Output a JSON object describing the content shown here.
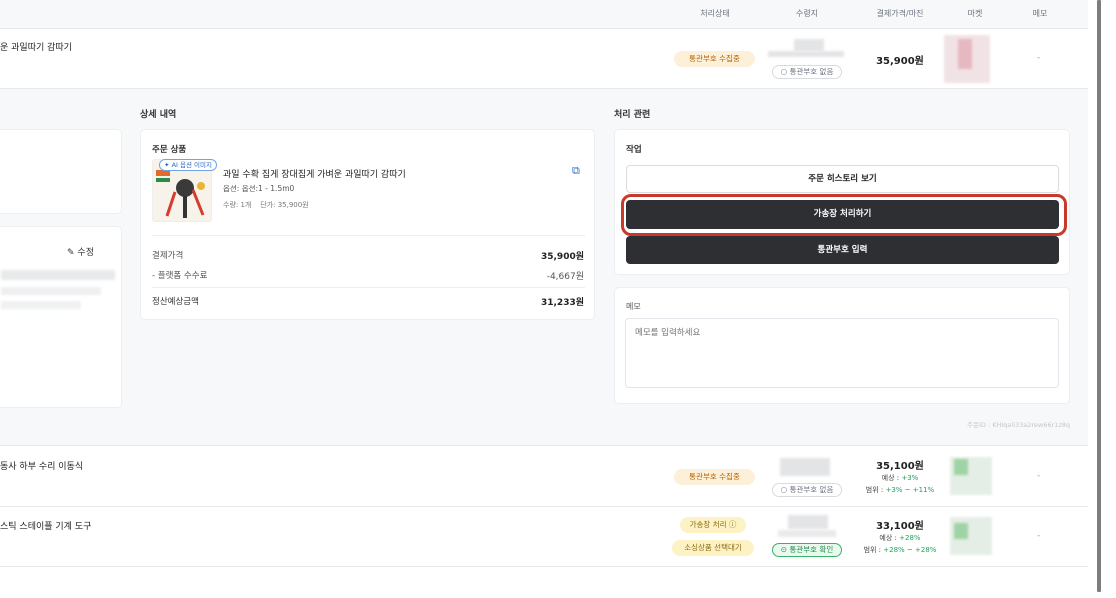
{
  "header": {
    "columns": [
      "처리상태",
      "수령지",
      "결제가격/마진",
      "마켓",
      "메모"
    ]
  },
  "rows": [
    {
      "title": "운 과일따기 감따기",
      "status": "통관부호 수집중",
      "customs_badge": "통관부호 없음",
      "price": "35,900원",
      "memo": "-"
    },
    {
      "title": "동사 하부 수리 이동식",
      "status": "통관부호 수집중",
      "customs_badge": "통관부호 없음",
      "price": "35,100원",
      "expected_label": "예상 : ",
      "expected_value": "+3%",
      "range_label": "범위 : ",
      "range_value": "+3% ~ +11%",
      "memo": "-"
    },
    {
      "title": "스틱 스테이플 기계 도구",
      "status": "가송장 처리",
      "status2": "소싱상품 선택대기",
      "customs_badge": "통관부호 확인",
      "price": "33,100원",
      "expected_label": "예상 : ",
      "expected_value": "+28%",
      "range_label": "범위 : ",
      "range_value": "+28% ~ +28%",
      "memo": "-"
    }
  ],
  "detail": {
    "section_title": "상세 내역",
    "edit_label": "수정",
    "order_product": {
      "title": "주문 상품",
      "ai_badge": "AI 옵션 이미지",
      "name": "과일 수확 집게 장대집게 가벼운 과일따기 감따기",
      "option": "옵션: 옵션:1 - 1.5m0",
      "qty_price": "수량: 1개    단가: 35,900원"
    },
    "payment_label": "결제가격",
    "payment_value": "35,900원",
    "fee_label": "- 플랫폼 수수료",
    "fee_value": "-4,667원",
    "settle_label": "정산예상금액",
    "settle_value": "31,233원"
  },
  "processing": {
    "section_title": "처리 관련",
    "work_title": "작업",
    "btn_history": "주문 히스토리 보기",
    "btn_temp_invoice": "가송장 처리하기",
    "btn_customs": "통관부호 입력",
    "memo_title": "메모",
    "memo_placeholder": "메모를 입력하세요",
    "order_id": "주문ID : KHIqali33a2rew66r1z8q"
  }
}
